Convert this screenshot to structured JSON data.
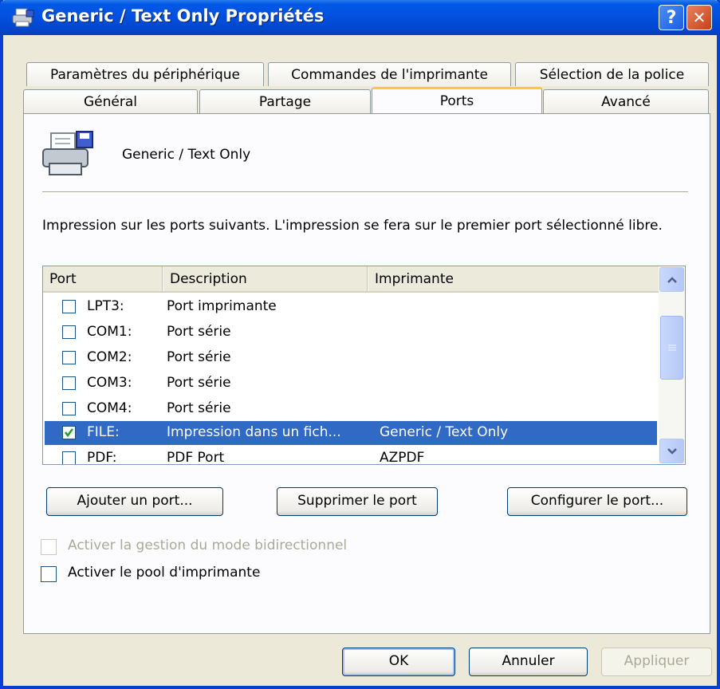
{
  "window": {
    "title": "Generic / Text Only Propriétés",
    "help_button": "?",
    "close_button": "✕"
  },
  "tabs": {
    "row_back": [
      {
        "label": "Paramètres du périphérique"
      },
      {
        "label": "Commandes de l'imprimante"
      },
      {
        "label": "Sélection de la police"
      }
    ],
    "row_front": [
      {
        "label": "Général"
      },
      {
        "label": "Partage"
      },
      {
        "label": "Ports",
        "active": true
      },
      {
        "label": "Avancé"
      }
    ]
  },
  "printer": {
    "icon": "printer-icon",
    "name": "Generic / Text Only"
  },
  "instructions": "Impression sur les ports suivants. L'impression se fera sur le premier port sélectionné libre.",
  "port_list": {
    "columns": [
      "Port",
      "Description",
      "Imprimante"
    ],
    "rows": [
      {
        "port": "LPT3:",
        "description": "Port imprimante",
        "printer": "",
        "checked": false
      },
      {
        "port": "COM1:",
        "description": "Port série",
        "printer": "",
        "checked": false
      },
      {
        "port": "COM2:",
        "description": "Port série",
        "printer": "",
        "checked": false
      },
      {
        "port": "COM3:",
        "description": "Port série",
        "printer": "",
        "checked": false
      },
      {
        "port": "COM4:",
        "description": "Port série",
        "printer": "",
        "checked": false
      },
      {
        "port": "FILE:",
        "description": "Impression dans un fich...",
        "printer": "Generic / Text Only",
        "checked": true,
        "selected": true
      },
      {
        "port": "PDF:",
        "description": "PDF Port",
        "printer": "AZPDF",
        "checked": false
      }
    ]
  },
  "buttons": {
    "add_port": "Ajouter un port...",
    "delete_port": "Supprimer le port",
    "configure_port": "Configurer le port...",
    "ok": "OK",
    "cancel": "Annuler",
    "apply": "Appliquer"
  },
  "options": {
    "bidirectional": {
      "label": "Activer la gestion du mode bidirectionnel",
      "checked": false,
      "enabled": false
    },
    "pooling": {
      "label": "Activer le pool d'imprimante",
      "checked": false,
      "enabled": true
    }
  },
  "colors": {
    "titlebar": "#0054e3",
    "selection": "#316ac5",
    "active_tab_accent": "#ffc83c"
  }
}
